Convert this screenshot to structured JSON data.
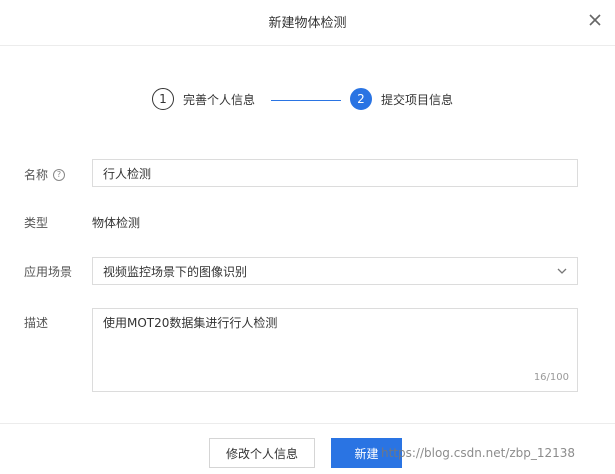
{
  "dialog": {
    "title": "新建物体检测",
    "close_icon": "close-icon"
  },
  "steps": [
    {
      "number": "1",
      "label": "完善个人信息",
      "state": "done"
    },
    {
      "number": "2",
      "label": "提交项目信息",
      "state": "active"
    }
  ],
  "form": {
    "name": {
      "label": "名称",
      "value": "行人检测",
      "help_icon": "question-circle-icon"
    },
    "type": {
      "label": "类型",
      "value": "物体检测"
    },
    "scenario": {
      "label": "应用场景",
      "value": "视频监控场景下的图像识别",
      "arrow_icon": "chevron-down-icon"
    },
    "description": {
      "label": "描述",
      "value": "使用MOT20数据集进行行人检测",
      "counter": "16/100"
    }
  },
  "footer": {
    "secondary_label": "修改个人信息",
    "primary_label": "新建"
  },
  "watermark": "https://blog.csdn.net/zbp_12138",
  "colors": {
    "accent": "#2a74e3",
    "border": "#dcdcdc"
  }
}
